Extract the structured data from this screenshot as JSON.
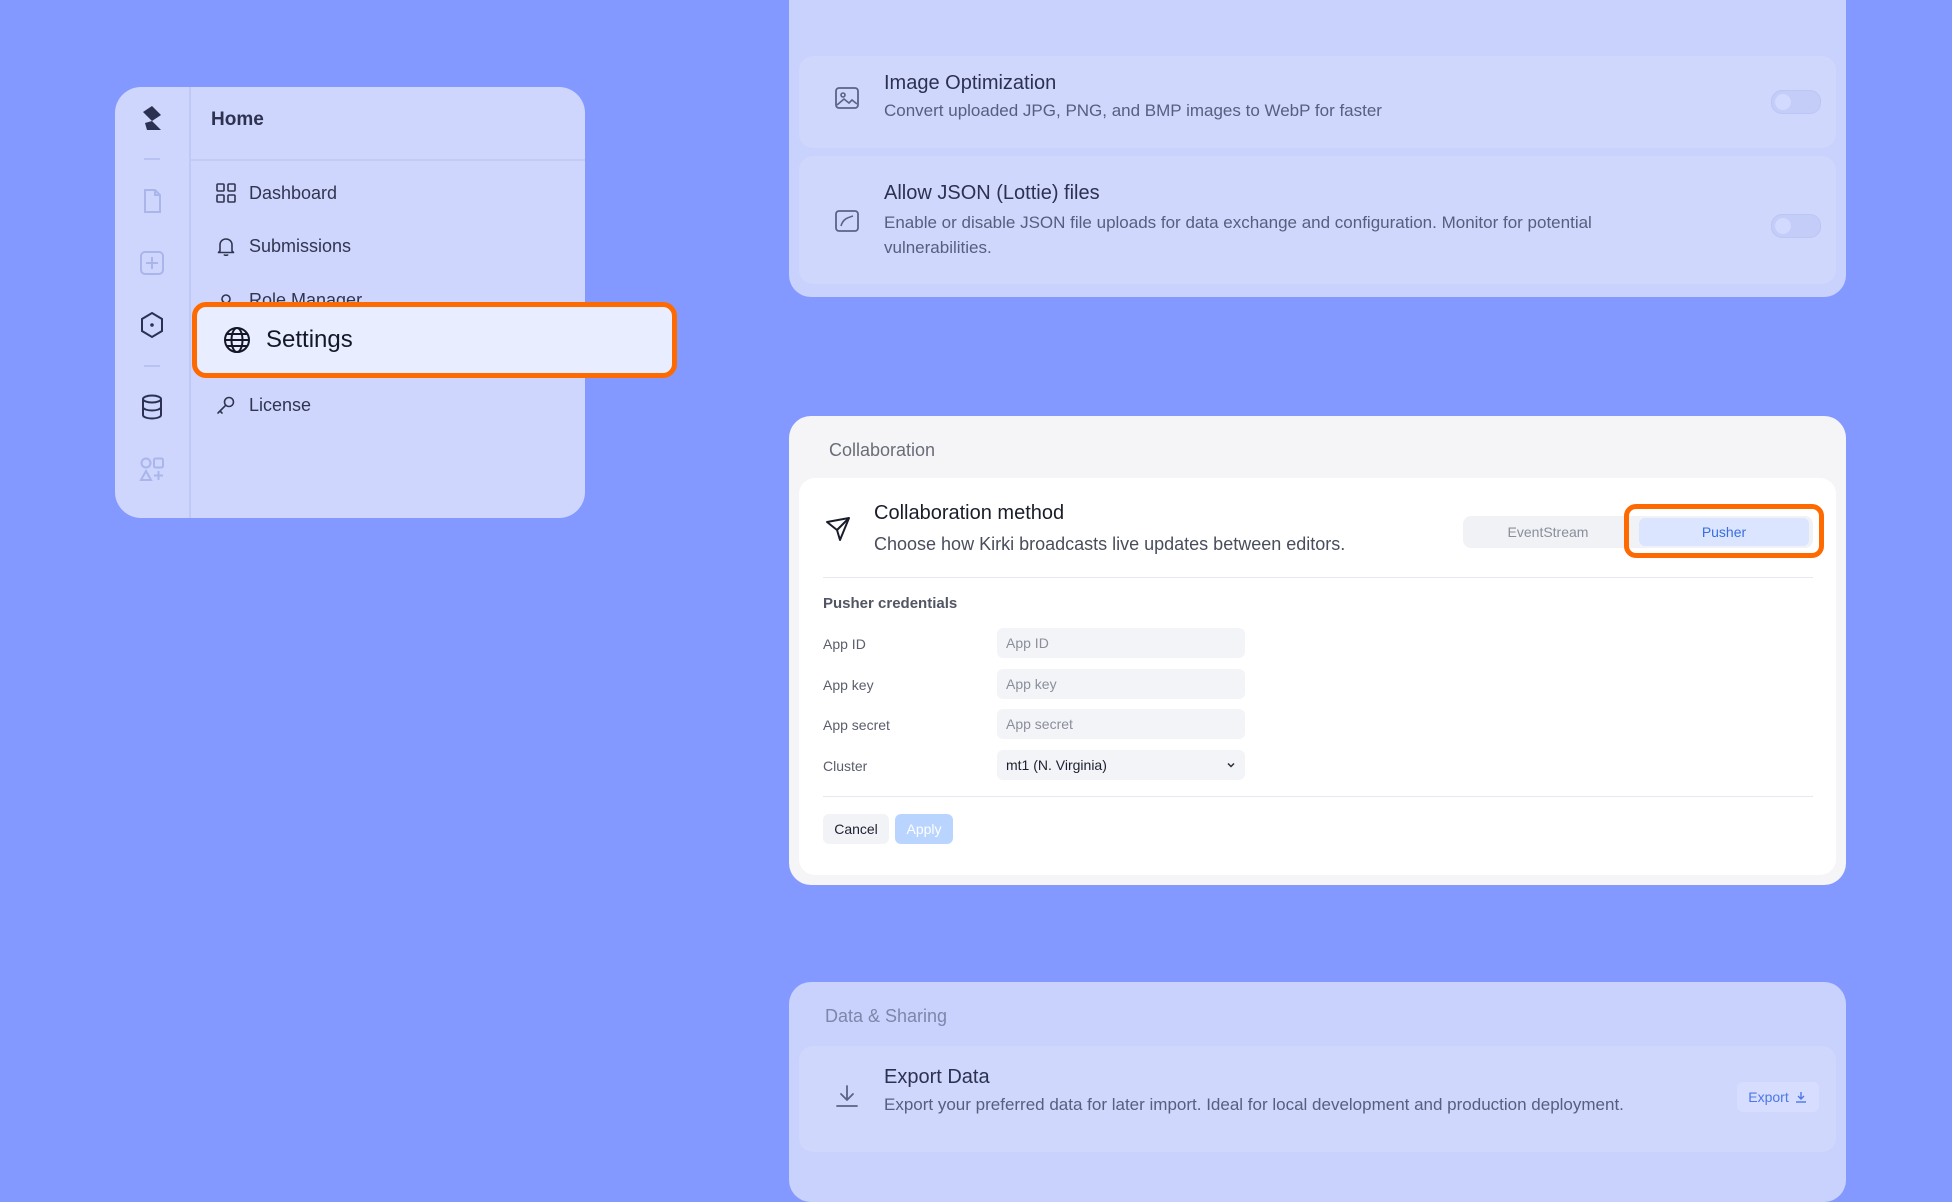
{
  "nav": {
    "title": "Home",
    "items": [
      {
        "label": "Dashboard",
        "icon": "grid-icon"
      },
      {
        "label": "Submissions",
        "icon": "bell-icon"
      },
      {
        "label": "Role Manager",
        "icon": "user-icon"
      },
      {
        "label": "Settings",
        "icon": "globe-icon",
        "active": true
      },
      {
        "label": "License",
        "icon": "key-icon"
      }
    ]
  },
  "settings_rows": {
    "image_optimization": {
      "title": "Image Optimization",
      "description": "Convert uploaded JPG, PNG, and BMP images to WebP for faster"
    },
    "allow_json": {
      "title": "Allow JSON (Lottie) files",
      "description": "Enable or disable JSON file uploads for data exchange and configuration. Monitor for potential vulnerabilities."
    }
  },
  "collaboration": {
    "section_title": "Collaboration",
    "method_title": "Collaboration method",
    "method_description": "Choose how Kirki broadcasts live updates between editors.",
    "options": [
      "EventStream",
      "Pusher"
    ],
    "selected": "Pusher",
    "credentials_title": "Pusher credentials",
    "fields": {
      "app_id": {
        "label": "App ID",
        "placeholder": "App ID"
      },
      "app_key": {
        "label": "App key",
        "placeholder": "App key"
      },
      "app_secret": {
        "label": "App secret",
        "placeholder": "App secret"
      },
      "cluster": {
        "label": "Cluster",
        "value": "mt1 (N. Virginia)"
      }
    },
    "cancel_label": "Cancel",
    "apply_label": "Apply"
  },
  "data_sharing": {
    "section_title": "Data & Sharing",
    "export": {
      "title": "Export Data",
      "description": "Export your preferred data for later import. Ideal for local development and production deployment.",
      "button_label": "Export"
    }
  },
  "colors": {
    "background": "#8399ff",
    "highlight": "#ff6a00",
    "accent": "#3a6ee0"
  }
}
